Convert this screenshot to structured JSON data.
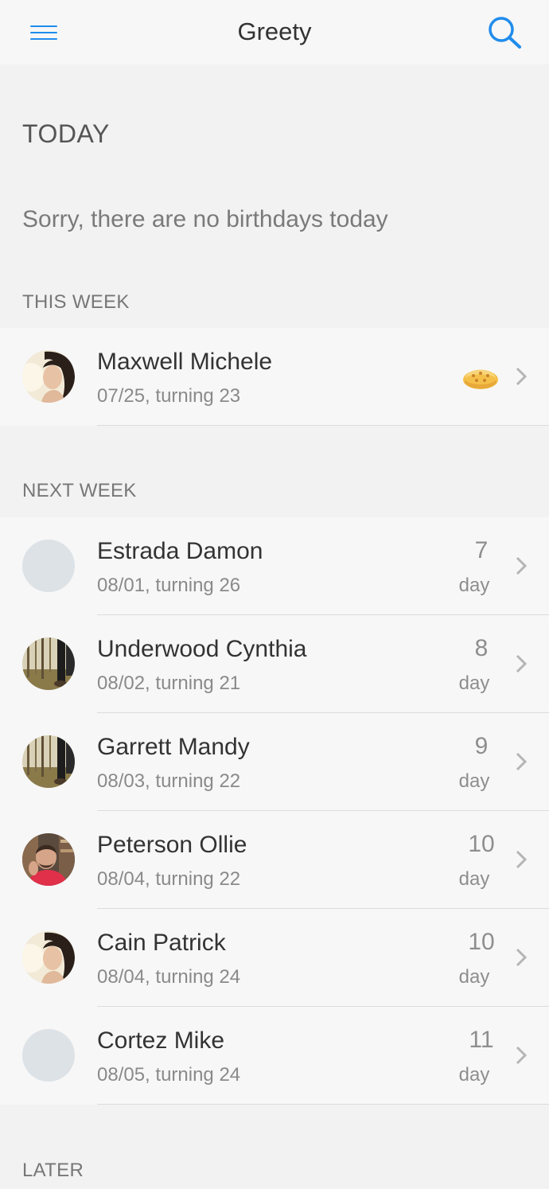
{
  "header": {
    "title": "Greety",
    "menu_icon": "hamburger-menu-icon",
    "search_icon": "search-icon",
    "accent_color": "#1f8cec"
  },
  "today": {
    "title": "TODAY",
    "empty_message": "Sorry, there are no birthdays today"
  },
  "this_week": {
    "label": "THIS WEEK",
    "items": [
      {
        "name": "Maxwell Michele",
        "sub": "07/25, turning 23",
        "badge_icon": "cake-icon",
        "avatar": "photo-woman"
      }
    ]
  },
  "next_week": {
    "label": "NEXT WEEK",
    "items": [
      {
        "name": "Estrada Damon",
        "sub": "08/01, turning 26",
        "days": "7",
        "unit": "day",
        "avatar": "placeholder"
      },
      {
        "name": "Underwood Cynthia",
        "sub": "08/02, turning 21",
        "days": "8",
        "unit": "day",
        "avatar": "photo-forest"
      },
      {
        "name": "Garrett Mandy",
        "sub": "08/03, turning 22",
        "days": "9",
        "unit": "day",
        "avatar": "photo-forest"
      },
      {
        "name": "Peterson Ollie",
        "sub": "08/04, turning 22",
        "days": "10",
        "unit": "day",
        "avatar": "photo-man"
      },
      {
        "name": "Cain Patrick",
        "sub": "08/04, turning 24",
        "days": "10",
        "unit": "day",
        "avatar": "photo-woman"
      },
      {
        "name": "Cortez Mike",
        "sub": "08/05, turning 24",
        "days": "11",
        "unit": "day",
        "avatar": "placeholder"
      }
    ]
  },
  "later": {
    "label": "LATER"
  }
}
